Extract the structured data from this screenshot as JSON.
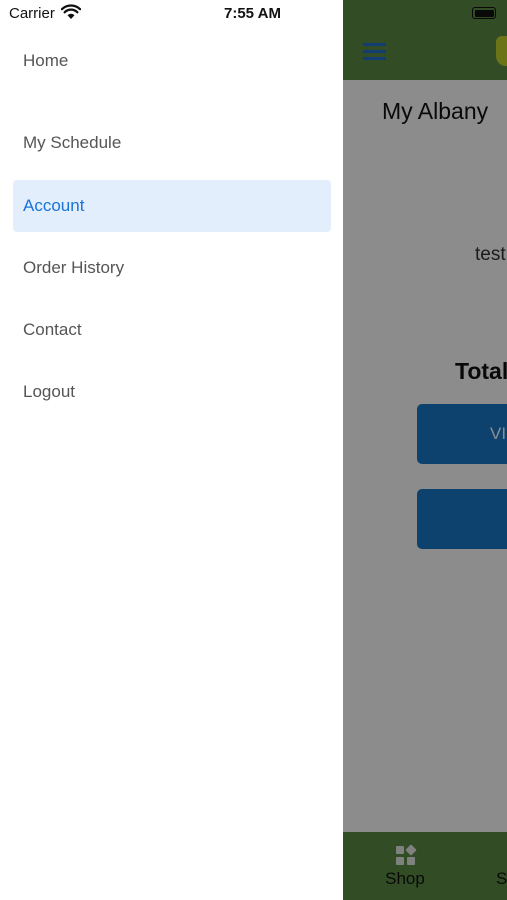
{
  "status_bar": {
    "carrier": "Carrier",
    "time": "7:55 AM"
  },
  "drawer": {
    "items": [
      {
        "label": "Home",
        "active": false
      },
      {
        "label": "My Schedule",
        "active": false
      },
      {
        "label": "Account",
        "active": true
      },
      {
        "label": "Order History",
        "active": false
      },
      {
        "label": "Contact",
        "active": false
      },
      {
        "label": "Logout",
        "active": false
      }
    ]
  },
  "background_app": {
    "heading": "My Albany",
    "email_partial": "test",
    "total_label": "Total",
    "button_1_label": "VI",
    "button_2_label": "",
    "tabs": [
      {
        "label": "Shop",
        "icon": "shop-icon"
      },
      {
        "label": "S"
      }
    ]
  },
  "colors": {
    "accent": "#1a73d8",
    "active_bg": "#e2eefc",
    "header_green": "#5b8a45",
    "button_blue": "#1877c9"
  }
}
